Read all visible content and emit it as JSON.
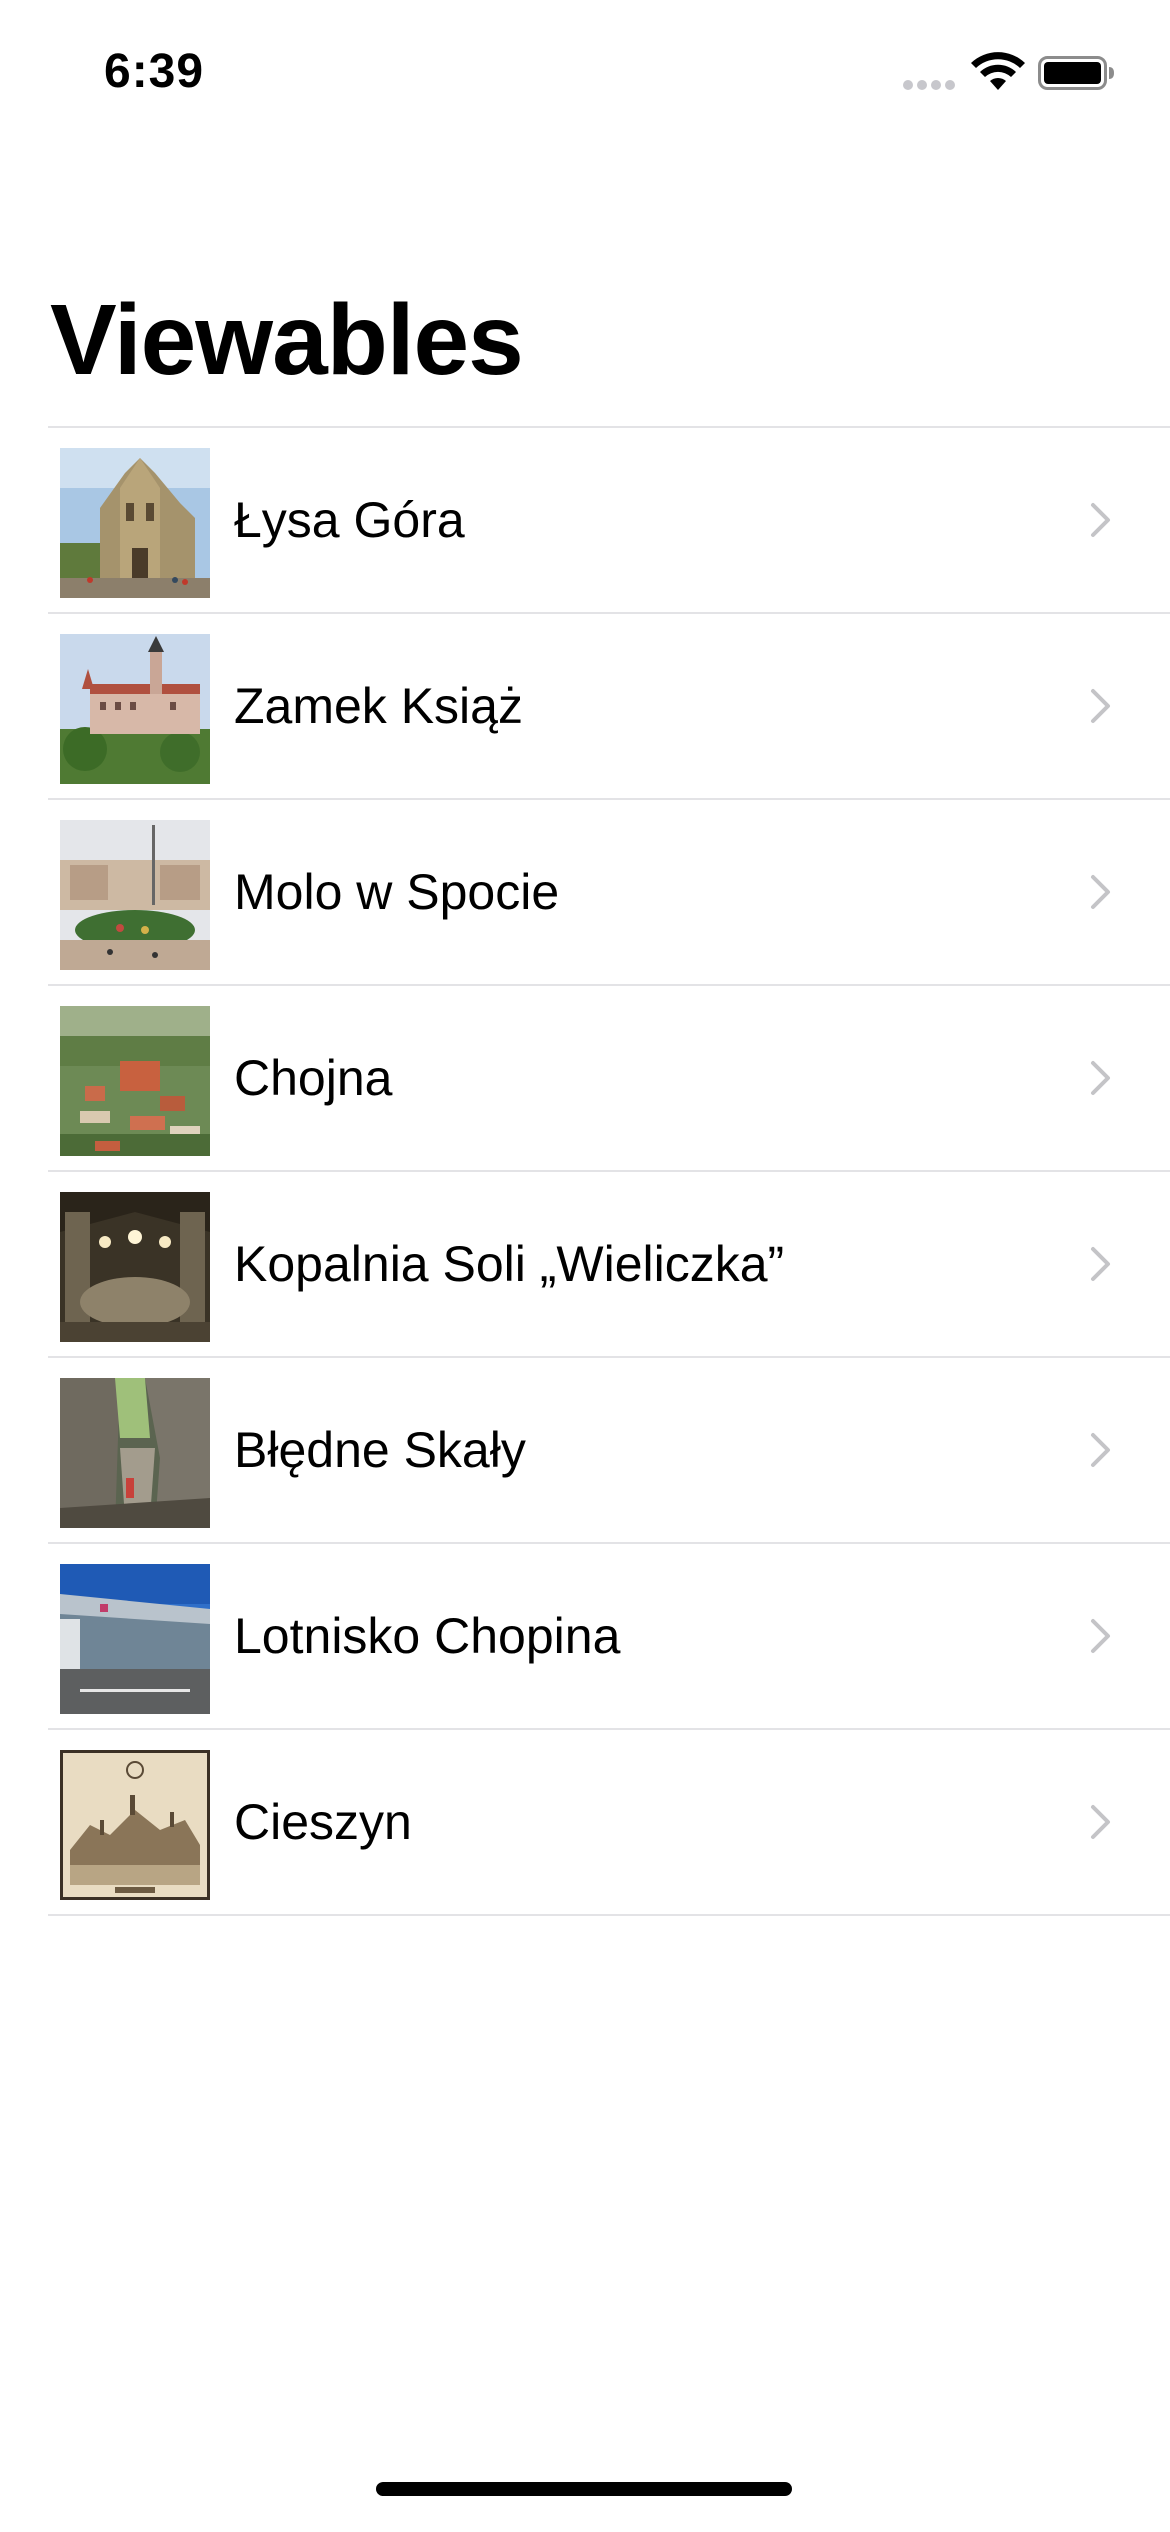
{
  "status_bar": {
    "time": "6:39"
  },
  "navigation": {
    "title": "Viewables"
  },
  "list": {
    "items": [
      {
        "label": "Łysa Góra",
        "image": "church-photo"
      },
      {
        "label": "Zamek Książ",
        "image": "castle-photo"
      },
      {
        "label": "Molo w Spocie",
        "image": "pier-square-photo"
      },
      {
        "label": "Chojna",
        "image": "aerial-town-photo"
      },
      {
        "label": "Kopalnia Soli „Wieliczka”",
        "image": "salt-mine-chamber-photo"
      },
      {
        "label": "Błędne Skały",
        "image": "rock-formation-photo"
      },
      {
        "label": "Lotnisko Chopina",
        "image": "airport-terminal-photo"
      },
      {
        "label": "Cieszyn",
        "image": "vintage-town-engraving"
      }
    ]
  },
  "colors": {
    "separator": "#e3e3e6",
    "chevron": "#c4c4c7",
    "text": "#000000",
    "background": "#ffffff"
  }
}
